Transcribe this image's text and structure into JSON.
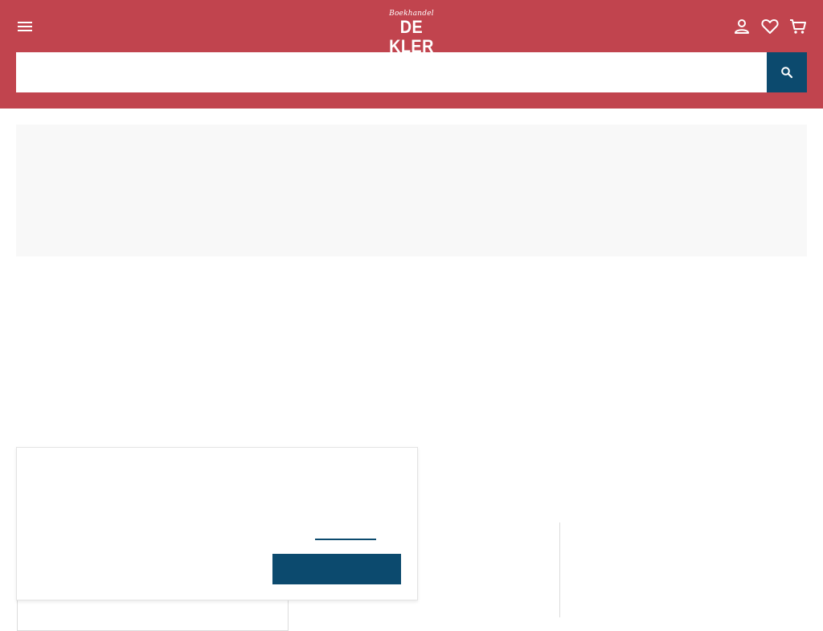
{
  "header": {
    "background_color": "#c1444e",
    "logo": {
      "script_text": "Boekhandel",
      "main_text": "DE KLER"
    },
    "icons": {
      "menu": "menu-icon",
      "account": "account-icon",
      "wishlist": "heart-icon",
      "cart": "cart-icon"
    }
  },
  "search": {
    "placeholder": "",
    "value": "",
    "button_icon": "search-icon",
    "button_color": "#0c4a6e"
  },
  "cookie_dialog": {
    "link_label": "",
    "accept_label": "",
    "accent_color": "#0c4a6e"
  }
}
